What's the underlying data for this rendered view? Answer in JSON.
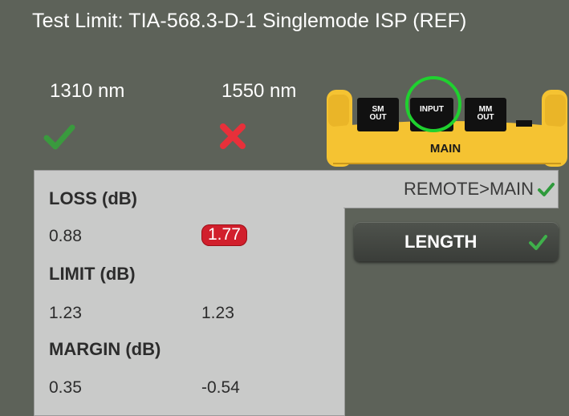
{
  "header": {
    "title": "Test Limit: TIA-568.3-D-1 Singlemode ISP (REF)"
  },
  "wavelengths": [
    {
      "label": "1310 nm",
      "result": "pass",
      "result_icon": "check-icon",
      "color": "#3a9a3e"
    },
    {
      "label": "1550 nm",
      "result": "fail",
      "result_icon": "x-icon",
      "color": "#e8303a"
    }
  ],
  "device": {
    "ports": {
      "sm_out_line1": "SM",
      "sm_out_line2": "OUT",
      "input": "INPUT",
      "mm_out_line1": "MM",
      "mm_out_line2": "OUT"
    },
    "unit_label": "MAIN",
    "highlighted_port": "INPUT",
    "highlight_color": "#1fd12f",
    "body_color": "#f5c332"
  },
  "results": {
    "loss": {
      "header": "LOSS (dB)",
      "values": [
        "0.88",
        "1.77"
      ]
    },
    "limit": {
      "header": "LIMIT (dB)",
      "values": [
        "1.23",
        "1.23"
      ]
    },
    "margin": {
      "header": "MARGIN (dB)",
      "values": [
        "0.35",
        "-0.54"
      ]
    },
    "fail_badge_color": "#d11f2c"
  },
  "tabs": {
    "direction": {
      "label": "REMOTE>MAIN",
      "status": "pass"
    },
    "length": {
      "label": "LENGTH",
      "status": "pass"
    }
  }
}
